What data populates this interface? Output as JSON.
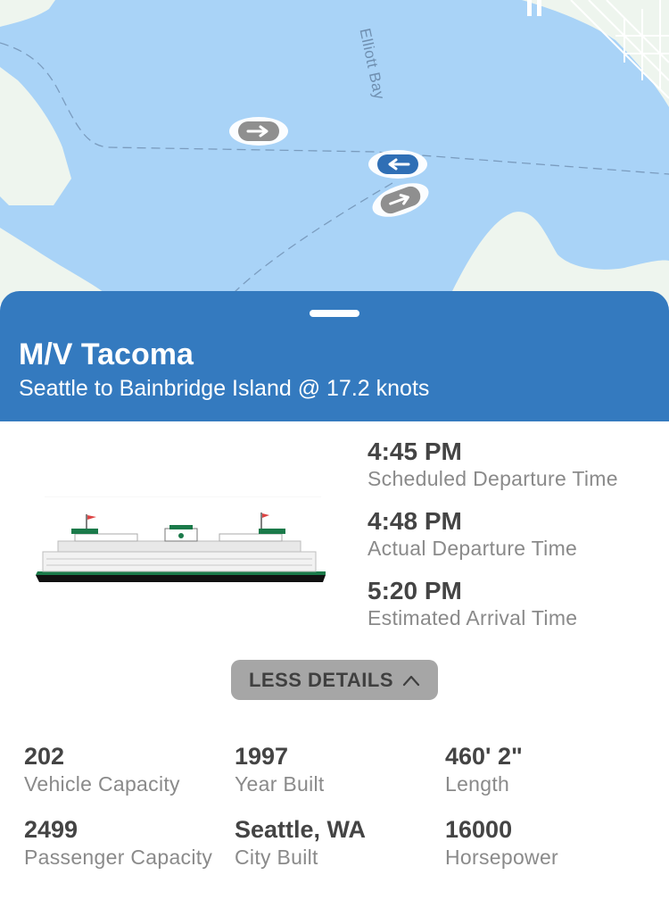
{
  "map": {
    "water_label": "Elliott Bay",
    "colors": {
      "water": "#a9d3f7",
      "land": "#eef5ee",
      "vessel_active": "#2f6fb5",
      "vessel_inactive": "#8f8f8f"
    },
    "markers": [
      {
        "name": "ferry-marker-eastbound-1",
        "icon": "arrow-right-icon",
        "state": "inactive"
      },
      {
        "name": "ferry-marker-selected",
        "icon": "arrow-left-icon",
        "state": "active"
      },
      {
        "name": "ferry-marker-eastbound-2",
        "icon": "arrow-right-icon",
        "state": "inactive"
      }
    ]
  },
  "vessel": {
    "name": "M/V Tacoma",
    "route": "Seattle to Bainbridge Island @ 17.2 knots",
    "times": [
      {
        "value": "4:45 PM",
        "label": "Scheduled Departure Time"
      },
      {
        "value": "4:48 PM",
        "label": "Actual Departure Time"
      },
      {
        "value": "5:20 PM",
        "label": "Estimated Arrival Time"
      }
    ],
    "toggle_label": "LESS DETAILS",
    "specs": [
      {
        "value": "202",
        "label": "Vehicle Capacity"
      },
      {
        "value": "1997",
        "label": "Year Built"
      },
      {
        "value": "460' 2\"",
        "label": "Length"
      },
      {
        "value": "2499",
        "label": "Passenger Capacity"
      },
      {
        "value": "Seattle, WA",
        "label": "City Built"
      },
      {
        "value": "16000",
        "label": "Horsepower"
      }
    ],
    "header_color": "#347abf"
  }
}
